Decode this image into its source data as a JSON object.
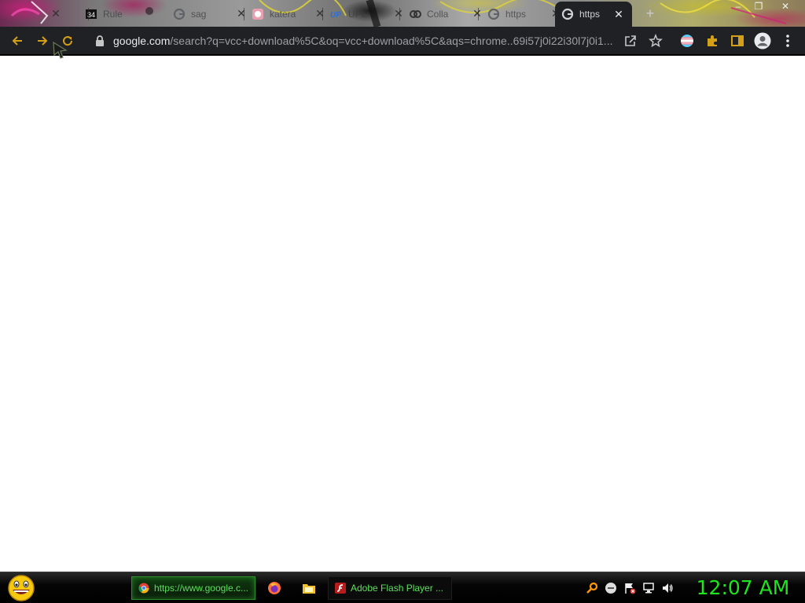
{
  "browser": {
    "tabs": [
      {
        "title": "Rule",
        "icon": "rule34-icon"
      },
      {
        "title": "sag",
        "icon": "google-icon"
      },
      {
        "title": "katera",
        "icon": "katera-icon"
      },
      {
        "title": "UPL",
        "icon": "up-icon"
      },
      {
        "title": "Colla",
        "icon": "colab-icon"
      },
      {
        "title": "https",
        "icon": "google-icon"
      },
      {
        "title": "https",
        "icon": "google-icon",
        "active": true
      }
    ],
    "close_glyph": "✕",
    "new_tab_glyph": "+",
    "window_controls": {
      "minimize": "–",
      "restore": "❐",
      "close": "✕"
    },
    "omnibox": {
      "host": "google.com",
      "path": "/search?q=vcc+download%5C&oq=vcc+download%5C&aqs=chrome..69i57j0i22i30l7j0i1..."
    }
  },
  "taskbar": {
    "items": [
      {
        "label": "https://www.google.c...",
        "icon": "chrome-icon",
        "active": true
      },
      {
        "label": "Adobe Flash Player ...",
        "icon": "flash-icon",
        "active": false
      }
    ],
    "clock": "12:07 AM"
  },
  "colors": {
    "toolbar_bg": "#202124",
    "taskbar_text": "#5be05b",
    "clock": "#1ee51e",
    "toolbar_icon_gold": "#d4a017"
  }
}
